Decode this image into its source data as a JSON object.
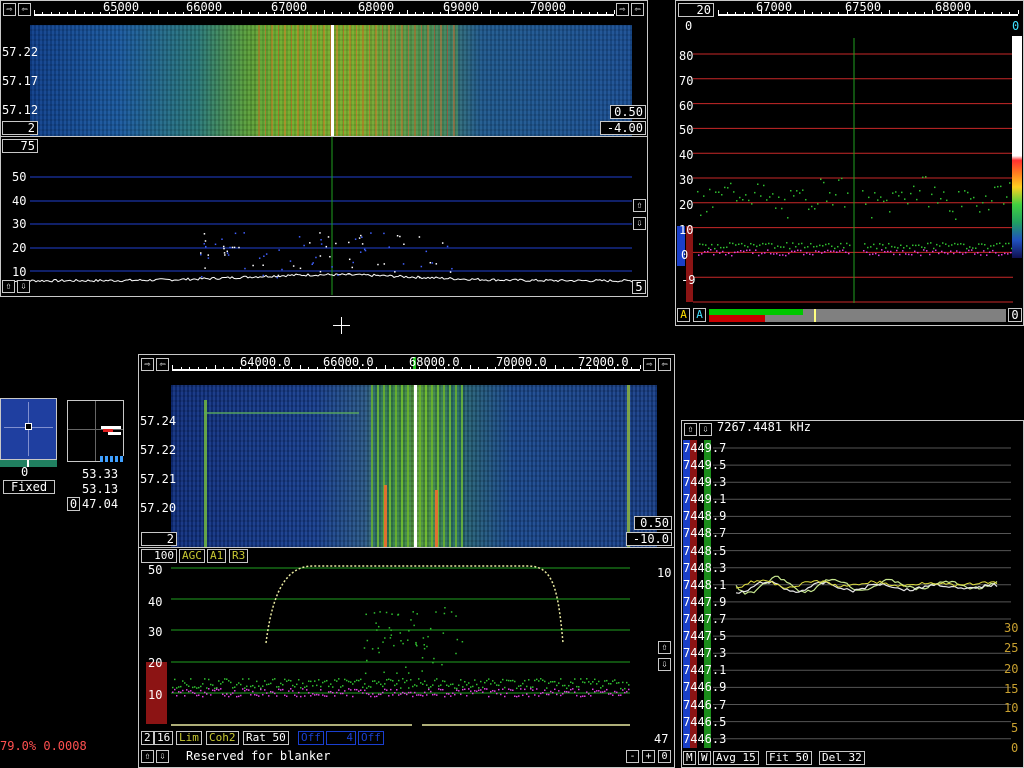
{
  "colors": {
    "accent_green": "#2fb52f",
    "grid_blue": "#1f3fd0",
    "grid_red": "#c82828",
    "amber": "#c8a030",
    "status_red": "#ff5050"
  },
  "wf1": {
    "freq_ticks": [
      "65000",
      "66000",
      "67000",
      "68000",
      "69000",
      "70000"
    ],
    "time_labels": [
      "57.22",
      "57.17",
      "57.12"
    ],
    "box_right_top": "0.50",
    "box_right_bottom": "-4.00",
    "box_left": "2",
    "box_spectrum_top": "75"
  },
  "spec1": {
    "y_labels": [
      "50",
      "40",
      "30",
      "20",
      "10"
    ],
    "box_right": "5"
  },
  "sm": {
    "box_top_left": "20",
    "freq_ticks": [
      "67000",
      "67500",
      "68000"
    ],
    "corner_top_left": "0",
    "corner_top_right": "0",
    "y_labels": [
      "80",
      "70",
      "60",
      "50",
      "40",
      "30",
      "20",
      "10",
      "0",
      "-9"
    ],
    "btn_a1": "A",
    "btn_a2": "A",
    "box_bottom_right": "0"
  },
  "mid": {
    "value1": "0",
    "fixed_label": "Fixed",
    "values": [
      "53.33",
      "53.13",
      "47.04"
    ],
    "small_box": "0"
  },
  "wf2": {
    "freq_ticks": [
      "64000.0",
      "66000.0",
      "68000.0",
      "70000.0",
      "72000.0"
    ],
    "time_labels": [
      "57.24",
      "57.22",
      "57.21",
      "57.20"
    ],
    "box_right_top": "0.50",
    "box_right_bottom": "-10.0",
    "box_left": "2"
  },
  "spec2": {
    "tags": [
      "100",
      "AGC",
      "A1",
      "R3"
    ],
    "y_labels": [
      "50",
      "40",
      "30",
      "20",
      "10"
    ],
    "right_label": "10",
    "bottom_tags": [
      "2",
      "16",
      "Lim",
      "Coh2",
      "Rat 50",
      "Off",
      "4",
      "Off"
    ],
    "right_value": "47",
    "reserved_label": "Reserved for blanker",
    "ctrl_minus": "-",
    "ctrl_plus": "+",
    "ctrl_zero": "0"
  },
  "freq": {
    "header": "7267.4481 kHz",
    "y_labels": [
      "7449.7",
      "7449.5",
      "7449.3",
      "7449.1",
      "7448.9",
      "7448.7",
      "7448.5",
      "7448.3",
      "7448.1",
      "7447.9",
      "7447.7",
      "7447.5",
      "7447.3",
      "7447.1",
      "7446.9",
      "7446.7",
      "7446.5",
      "7446.3"
    ],
    "right_labels": [
      "30",
      "25",
      "20",
      "15",
      "10",
      "5",
      "0"
    ],
    "bottom_tags": [
      "M",
      "W",
      "Avg 15",
      "Fit 50",
      "Del 32"
    ]
  },
  "status": {
    "text": "79.0% 0.0008"
  }
}
